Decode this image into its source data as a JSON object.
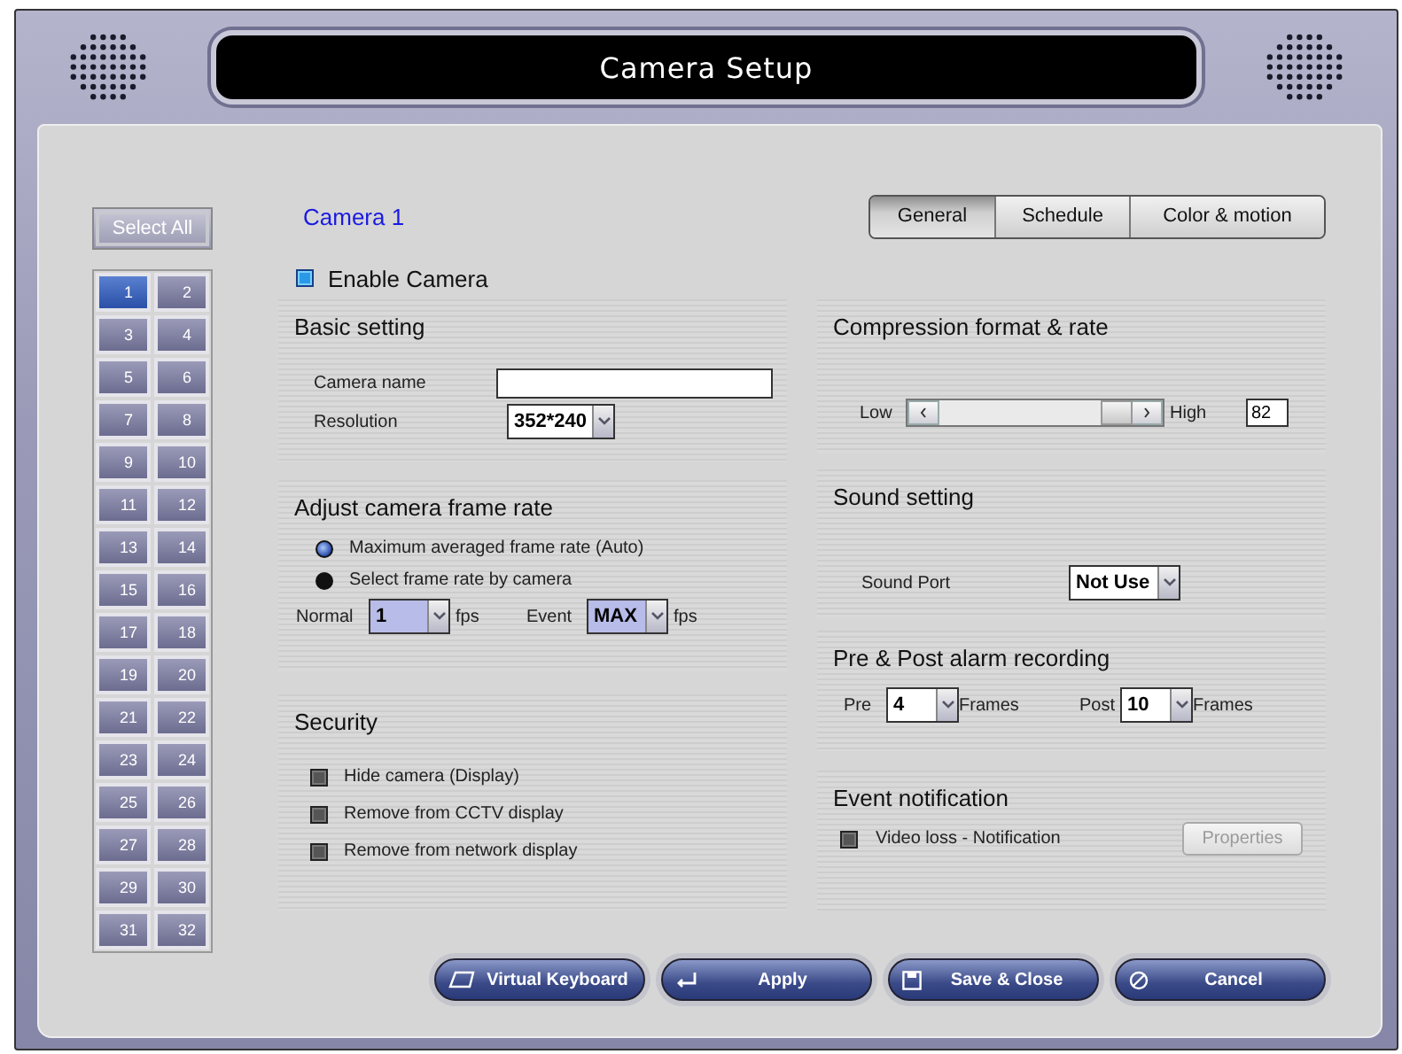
{
  "window": {
    "title": "Camera Setup"
  },
  "select_all": "Select All",
  "cameras": [
    {
      "label": "1",
      "selected": true
    },
    {
      "label": "2",
      "selected": false
    },
    {
      "label": "3",
      "selected": false
    },
    {
      "label": "4",
      "selected": false
    },
    {
      "label": "5",
      "selected": false
    },
    {
      "label": "6",
      "selected": false
    },
    {
      "label": "7",
      "selected": false
    },
    {
      "label": "8",
      "selected": false
    },
    {
      "label": "9",
      "selected": false
    },
    {
      "label": "10",
      "selected": false
    },
    {
      "label": "11",
      "selected": false
    },
    {
      "label": "12",
      "selected": false
    },
    {
      "label": "13",
      "selected": false
    },
    {
      "label": "14",
      "selected": false
    },
    {
      "label": "15",
      "selected": false
    },
    {
      "label": "16",
      "selected": false
    },
    {
      "label": "17",
      "selected": false
    },
    {
      "label": "18",
      "selected": false
    },
    {
      "label": "19",
      "selected": false
    },
    {
      "label": "20",
      "selected": false
    },
    {
      "label": "21",
      "selected": false
    },
    {
      "label": "22",
      "selected": false
    },
    {
      "label": "23",
      "selected": false
    },
    {
      "label": "24",
      "selected": false
    },
    {
      "label": "25",
      "selected": false
    },
    {
      "label": "26",
      "selected": false
    },
    {
      "label": "27",
      "selected": false
    },
    {
      "label": "28",
      "selected": false
    },
    {
      "label": "29",
      "selected": false
    },
    {
      "label": "30",
      "selected": false
    },
    {
      "label": "31",
      "selected": false
    },
    {
      "label": "32",
      "selected": false
    }
  ],
  "camera_title": "Camera 1",
  "tabs": [
    {
      "label": "General",
      "selected": true
    },
    {
      "label": "Schedule",
      "selected": false
    },
    {
      "label": "Color & motion",
      "selected": false
    }
  ],
  "enable_camera": {
    "label": "Enable Camera",
    "checked": true
  },
  "basic_setting": {
    "title": "Basic setting",
    "camera_name": {
      "label": "Camera name"
    },
    "resolution": {
      "label": "Resolution",
      "value": "352*240"
    }
  },
  "frame_rate": {
    "title": "Adjust camera frame rate",
    "options": [
      {
        "label": "Maximum averaged frame rate (Auto)",
        "selected": true
      },
      {
        "label": "Select frame rate by camera",
        "selected": false
      }
    ],
    "normal": {
      "label": "Normal",
      "value": "1",
      "unit": "fps"
    },
    "event": {
      "label": "Event",
      "value": "MAX",
      "unit": "fps"
    }
  },
  "security": {
    "title": "Security",
    "options": [
      {
        "label": "Hide camera (Display)",
        "checked": false
      },
      {
        "label": "Remove from CCTV display",
        "checked": false
      },
      {
        "label": "Remove from network display",
        "checked": false
      }
    ]
  },
  "compression": {
    "title": "Compression format & rate",
    "low_label": "Low",
    "high_label": "High",
    "level": 0.82,
    "value": "82"
  },
  "sound": {
    "title": "Sound setting",
    "port": {
      "label": "Sound Port",
      "value": "Not Use"
    }
  },
  "alarm": {
    "title": "Pre & Post alarm recording",
    "pre": {
      "label": "Pre",
      "value": "4",
      "unit": "Frames"
    },
    "post": {
      "label": "Post",
      "value": "10",
      "unit": "Frames"
    }
  },
  "event_notification": {
    "title": "Event notification",
    "option": {
      "label": "Video loss - Notification",
      "checked": false
    },
    "button": {
      "label": "Properties",
      "disabled": true
    }
  },
  "buttons": [
    {
      "label": "Virtual Keyboard",
      "kind": "keyboard"
    },
    {
      "label": "Apply",
      "kind": "apply"
    },
    {
      "label": "Save & Close",
      "kind": "save"
    },
    {
      "label": "Cancel",
      "kind": "cancel"
    }
  ]
}
